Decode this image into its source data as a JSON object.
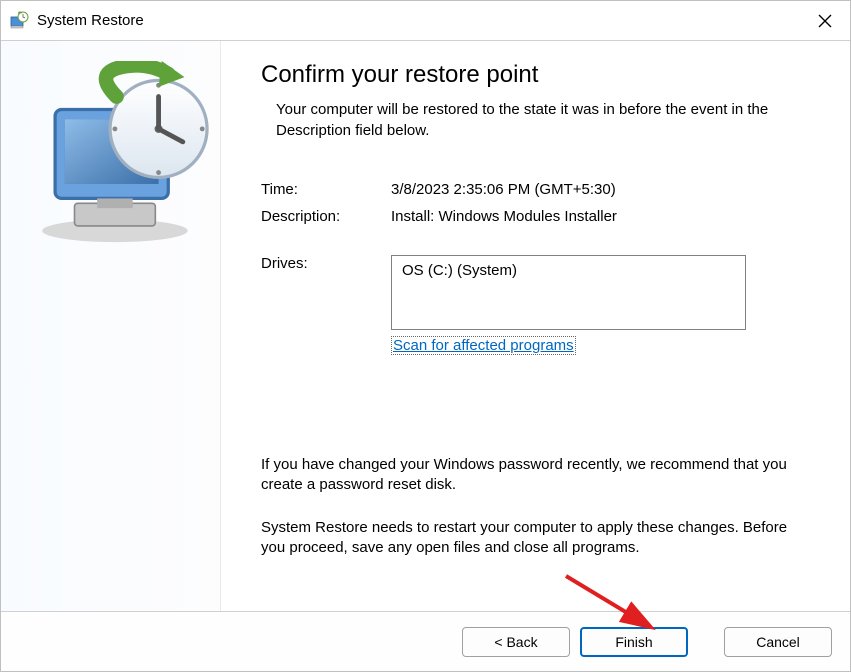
{
  "titlebar": {
    "title": "System Restore"
  },
  "content": {
    "heading": "Confirm your restore point",
    "subheading": "Your computer will be restored to the state it was in before the event in the Description field below.",
    "time_label": "Time:",
    "time_value": "3/8/2023 2:35:06 PM (GMT+5:30)",
    "description_label": "Description:",
    "description_value": "Install: Windows Modules Installer",
    "drives_label": "Drives:",
    "drives_value": "OS (C:) (System)",
    "scan_link": "Scan for affected programs",
    "warning1": "If you have changed your Windows password recently, we recommend that you create a password reset disk.",
    "warning2": "System Restore needs to restart your computer to apply these changes. Before you proceed, save any open files and close all programs."
  },
  "footer": {
    "back": "< Back",
    "finish": "Finish",
    "cancel": "Cancel"
  }
}
